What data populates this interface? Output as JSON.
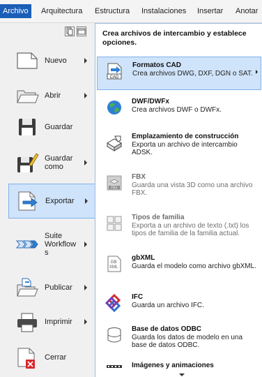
{
  "ribbon": {
    "tabs": [
      "Archivo",
      "Arquitectura",
      "Estructura",
      "Instalaciones",
      "Insertar",
      "Anotar"
    ],
    "active_color": "#1a5eb7"
  },
  "left_menu": {
    "items": [
      {
        "label": "Nuevo",
        "icon": "new-document-icon",
        "has_submenu": true
      },
      {
        "label": "Abrir",
        "icon": "open-folder-icon",
        "has_submenu": true
      },
      {
        "label": "Guardar",
        "icon": "save-disk-icon",
        "has_submenu": false
      },
      {
        "label": "Guardar como",
        "icon": "save-as-icon",
        "has_submenu": true
      },
      {
        "label": "Exportar",
        "icon": "export-icon",
        "has_submenu": true,
        "selected": true
      },
      {
        "label": "Suite Workflow s",
        "icon": "suite-workflows-icon",
        "has_submenu": true
      },
      {
        "label": "Publicar",
        "icon": "publish-icon",
        "has_submenu": true
      },
      {
        "label": "Imprimir",
        "icon": "printer-icon",
        "has_submenu": true
      },
      {
        "label": "Cerrar",
        "icon": "close-document-icon",
        "has_submenu": false
      }
    ]
  },
  "submenu": {
    "header": "Crea archivos de intercambio y establece opciones.",
    "items": [
      {
        "title": "Formatos CAD",
        "desc": "Crea archivos DWG, DXF, DGN o SAT.",
        "icon": "cad-formats-icon",
        "selected": true,
        "has_submenu": true
      },
      {
        "title": "DWF/DWFx",
        "desc": "Crea archivos DWF o DWFx.",
        "icon": "dwf-globe-icon"
      },
      {
        "title": "Emplazamiento de construcción",
        "desc": "Exporta un archivo de intercambio ADSK.",
        "icon": "building-site-icon"
      },
      {
        "title": "FBX",
        "desc": "Guarda una vista 3D como una archivo FBX.",
        "icon": "fbx-icon",
        "dim": true
      },
      {
        "title": "Tipos de familia",
        "desc": "Exporta a un archivo de texto (.txt) los tipos de familia de la familia actual.",
        "icon": "family-types-icon",
        "dim": true
      },
      {
        "title": "gbXML",
        "desc": "Guarda el modelo como archivo gbXML.",
        "icon": "gbxml-icon"
      },
      {
        "title": "IFC",
        "desc": "Guarda un archivo IFC.",
        "icon": "ifc-icon"
      },
      {
        "title": "Base de datos ODBC",
        "desc": "Guarda los datos de modelo en una base de datos ODBC.",
        "icon": "database-icon"
      },
      {
        "title": "Imágenes y animaciones",
        "desc": "",
        "icon": "images-animations-icon"
      }
    ]
  }
}
